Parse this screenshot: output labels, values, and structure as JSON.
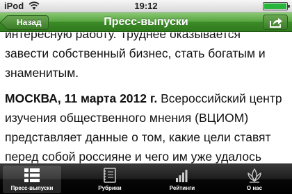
{
  "status_bar": {
    "carrier": "iPod",
    "time": "19:12",
    "battery_level": 1.0
  },
  "nav_bar": {
    "back_label": "Назад",
    "title": "Пресс-выпуски"
  },
  "article": {
    "intro": "интересную работу. Труднее оказывается завести собственный бизнес, стать богатым и знаменитым.",
    "dateline": "МОСКВА, 11 марта 2012 г.",
    "body": " Всероссийский центр изучения общественного мнения (ВЦИОМ) представляет данные о том, какие цели ставят перед собой россияне и чего им уже удалось добиться."
  },
  "tab_bar": {
    "tabs": [
      {
        "label": "Пресс-выпуски",
        "icon": "list-icon",
        "active": true
      },
      {
        "label": "Рубрики",
        "icon": "notebook-icon",
        "active": false
      },
      {
        "label": "Рейтинги",
        "icon": "bar-chart-icon",
        "active": false
      },
      {
        "label": "О нас",
        "icon": "lotus-logo-icon",
        "active": false
      }
    ]
  },
  "colors": {
    "nav_green": "#3d8a28",
    "tab_bar_black": "#000000",
    "battery_green": "#27b63b"
  }
}
